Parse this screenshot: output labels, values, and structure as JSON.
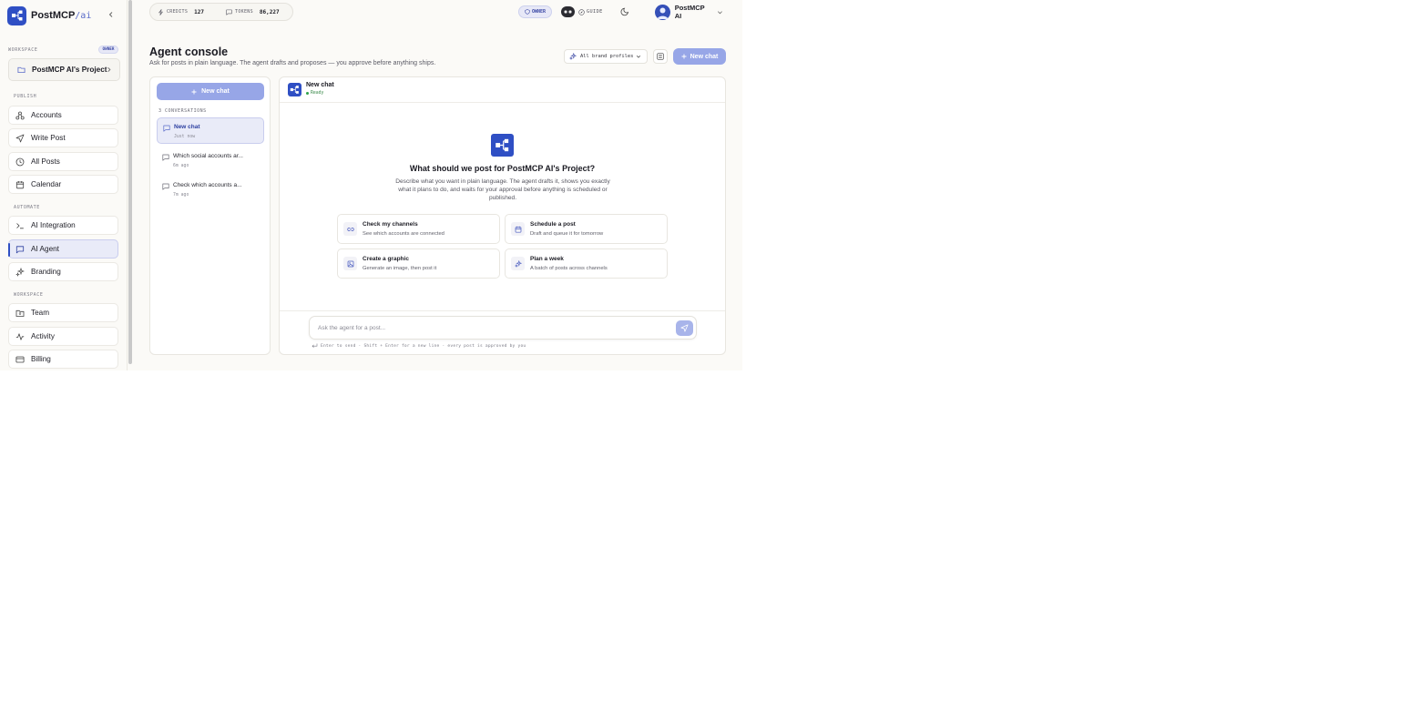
{
  "brand": {
    "name": "PostMCP",
    "suffix": "/ai"
  },
  "sidebar": {
    "workspace_label": "WORKSPACE",
    "owner_badge": "OWNER",
    "project_name": "PostMCP AI's Project",
    "sections": {
      "publish": "PUBLISH",
      "automate": "AUTOMATE",
      "workspace": "WORKSPACE"
    },
    "items": [
      {
        "label": "Accounts",
        "icon": "accounts-icon"
      },
      {
        "label": "Write Post",
        "icon": "send-icon"
      },
      {
        "label": "All Posts",
        "icon": "clock-icon"
      },
      {
        "label": "Calendar",
        "icon": "calendar-icon"
      },
      {
        "label": "AI Integration",
        "icon": "terminal-icon"
      },
      {
        "label": "AI Agent",
        "icon": "chat-icon",
        "active": true
      },
      {
        "label": "Branding",
        "icon": "sparkles-icon"
      },
      {
        "label": "Team",
        "icon": "folder-icon"
      },
      {
        "label": "Activity",
        "icon": "activity-icon"
      },
      {
        "label": "Billing",
        "icon": "card-icon"
      }
    ]
  },
  "topbar": {
    "credits_label": "CREDITS",
    "credits_value": "127",
    "tokens_label": "TOKENS",
    "tokens_value": "86,227",
    "role": "OWNER",
    "guide": "GUIDE",
    "user_name": "PostMCP AI"
  },
  "header": {
    "title": "Agent console",
    "subtitle": "Ask for posts in plain language. The agent drafts and proposes — you approve before anything ships.",
    "brand_select": "All brand profiles",
    "new_chat": "New chat"
  },
  "conversations": {
    "new_chat": "New chat",
    "count_label": "3 CONVERSATIONS",
    "items": [
      {
        "title": "New chat",
        "ago": "Just now",
        "active": true
      },
      {
        "title": "Which social accounts ar...",
        "ago": "6m ago"
      },
      {
        "title": "Check which accounts a...",
        "ago": "7m ago"
      }
    ]
  },
  "chat": {
    "title": "New chat",
    "status": "Ready",
    "hero_title": "What should we post for PostMCP AI's Project?",
    "hero_subtitle": "Describe what you want in plain language. The agent drafts it, shows you exactly what it plans to do, and waits for your approval before anything is scheduled or published.",
    "suggestions": [
      {
        "title": "Check my channels",
        "desc": "See which accounts are connected",
        "icon": "link-icon"
      },
      {
        "title": "Schedule a post",
        "desc": "Draft and queue it for tomorrow",
        "icon": "calendar-icon"
      },
      {
        "title": "Create a graphic",
        "desc": "Generate an image, then post it",
        "icon": "image-icon"
      },
      {
        "title": "Plan a week",
        "desc": "A batch of posts across channels",
        "icon": "sparkles-icon"
      }
    ],
    "composer_placeholder": "Ask the agent for a post...",
    "hint": "Enter to send · Shift + Enter for a new line · every post is approved by you"
  },
  "colors": {
    "accent": "#2f4fc4",
    "accent_light": "#97a6e7",
    "active_bg": "#e9ebf8",
    "status_green": "#2fa34a"
  }
}
